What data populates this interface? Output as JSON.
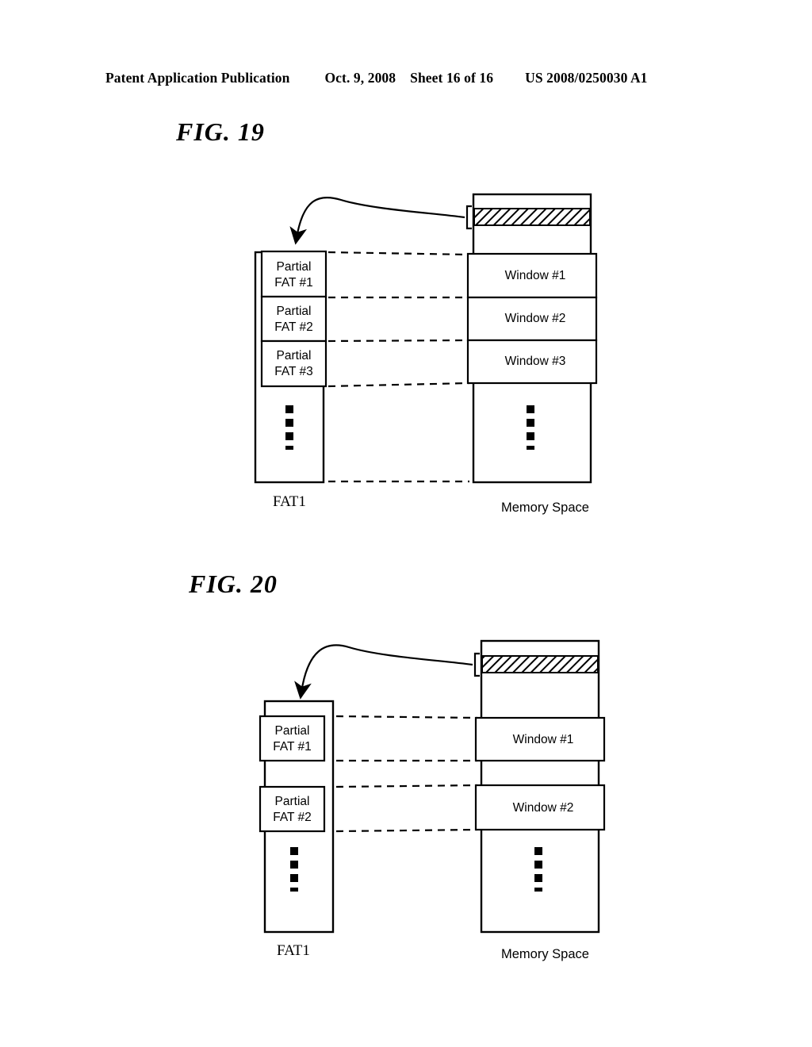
{
  "header": {
    "publication": "Patent Application Publication",
    "date": "Oct. 9, 2008",
    "sheet": "Sheet 16 of 16",
    "patent_number": "US 2008/0250030 A1"
  },
  "figures": [
    {
      "id": "fig19",
      "title": "FIG. 19",
      "left_column": {
        "caption": "FAT1",
        "ellipsis": "vertical-ellipsis",
        "blocks": [
          {
            "line1": "Partial",
            "line2": "FAT #1"
          },
          {
            "line1": "Partial",
            "line2": "FAT #2"
          },
          {
            "line1": "Partial",
            "line2": "FAT #3"
          }
        ]
      },
      "right_column": {
        "caption": "Memory Space",
        "hatched_band": "hatched-region",
        "ellipsis": "vertical-ellipsis",
        "blocks": [
          {
            "label": "Window #1"
          },
          {
            "label": "Window #2"
          },
          {
            "label": "Window #3"
          }
        ]
      },
      "connectors": {
        "count": 4,
        "style": "dashed"
      },
      "arrow": "curved-arrow-from-hatched-band-to-fat-column"
    },
    {
      "id": "fig20",
      "title": "FIG. 20",
      "left_column": {
        "caption": "FAT1",
        "ellipsis": "vertical-ellipsis",
        "blocks": [
          {
            "line1": "Partial",
            "line2": "FAT #1"
          },
          {
            "line1": "Partial",
            "line2": "FAT #2"
          }
        ]
      },
      "right_column": {
        "caption": "Memory Space",
        "hatched_band": "hatched-region",
        "ellipsis": "vertical-ellipsis",
        "blocks": [
          {
            "label": "Window #1"
          },
          {
            "label": "Window #2"
          }
        ]
      },
      "connectors": {
        "count": 4,
        "style": "dashed"
      },
      "arrow": "curved-arrow-from-hatched-band-to-fat-column"
    }
  ],
  "colors": {
    "ink": "#000000",
    "paper": "#ffffff"
  }
}
